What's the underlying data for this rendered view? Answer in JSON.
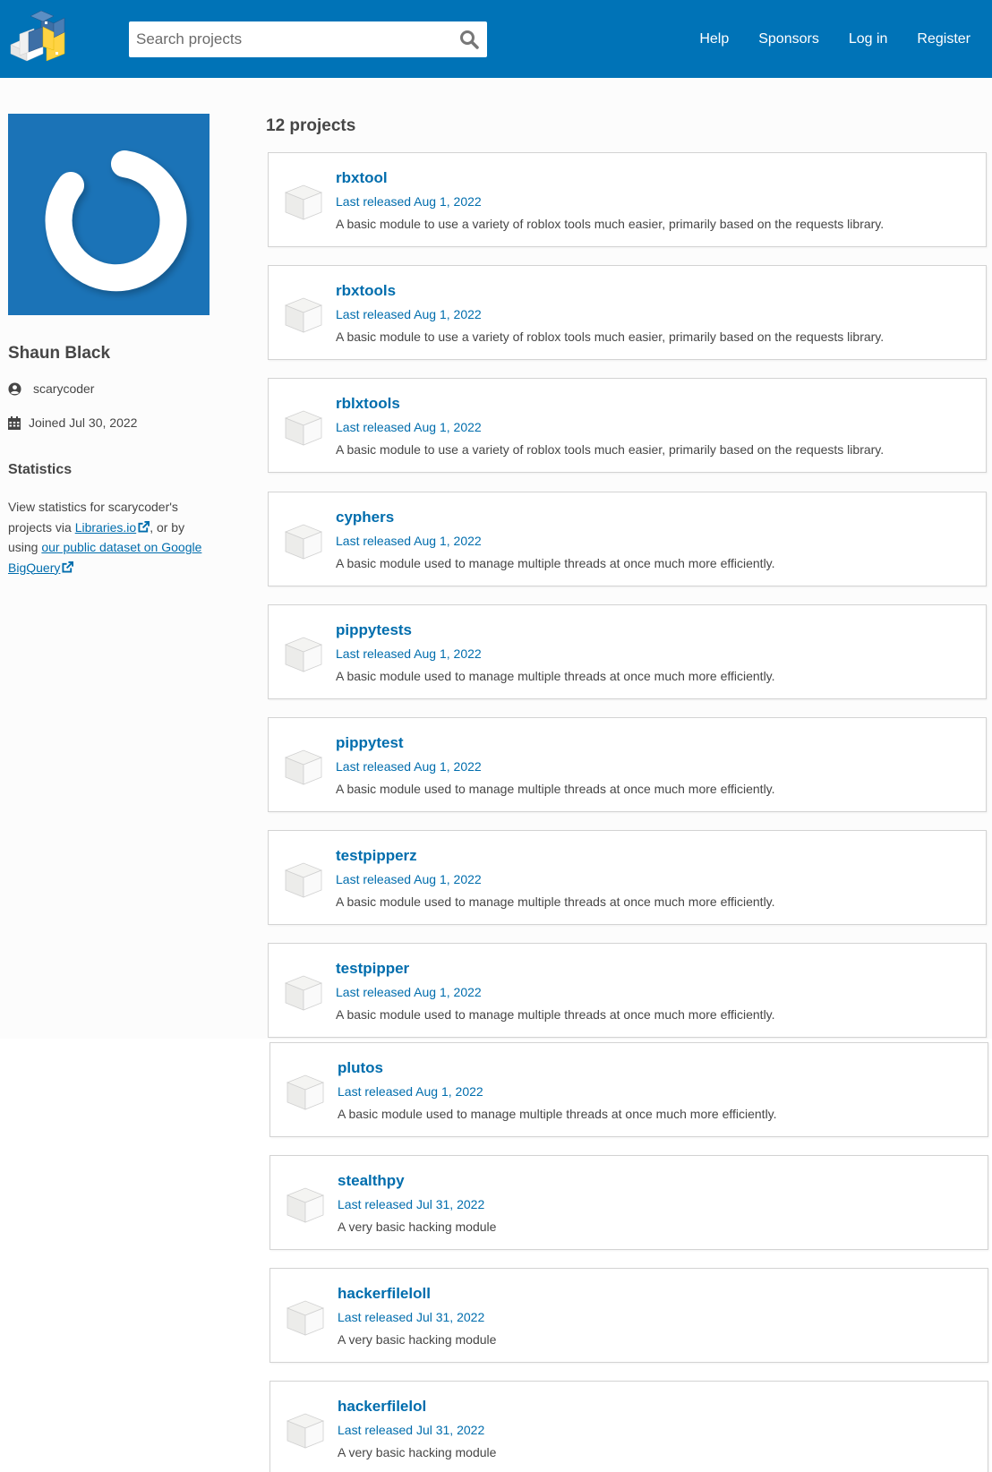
{
  "header": {
    "search_placeholder": "Search projects",
    "nav": [
      "Help",
      "Sponsors",
      "Log in",
      "Register"
    ],
    "brand_color": "#0073b7"
  },
  "profile": {
    "name": "Shaun Black",
    "username": "scarycoder",
    "joined": "Joined Jul 30, 2022",
    "statistics_title": "Statistics",
    "stats_text_1": "View statistics for scarycoder's projects via ",
    "stats_link_1": "Libraries.io",
    "stats_text_2": ", or by using ",
    "stats_link_2": "our public dataset on Google BigQuery"
  },
  "projects_count": "12 projects",
  "projects": [
    {
      "name": "rbxtool",
      "released": "Last released Aug 1, 2022",
      "description": "A basic module to use a variety of roblox tools much easier, primarily based on the requests library."
    },
    {
      "name": "rbxtools",
      "released": "Last released Aug 1, 2022",
      "description": "A basic module to use a variety of roblox tools much easier, primarily based on the requests library."
    },
    {
      "name": "rblxtools",
      "released": "Last released Aug 1, 2022",
      "description": "A basic module to use a variety of roblox tools much easier, primarily based on the requests library."
    },
    {
      "name": "cyphers",
      "released": "Last released Aug 1, 2022",
      "description": "A basic module used to manage multiple threads at once much more efficiently."
    },
    {
      "name": "pippytests",
      "released": "Last released Aug 1, 2022",
      "description": "A basic module used to manage multiple threads at once much more efficiently."
    },
    {
      "name": "pippytest",
      "released": "Last released Aug 1, 2022",
      "description": "A basic module used to manage multiple threads at once much more efficiently."
    },
    {
      "name": "testpipperz",
      "released": "Last released Aug 1, 2022",
      "description": "A basic module used to manage multiple threads at once much more efficiently."
    },
    {
      "name": "testpipper",
      "released": "Last released Aug 1, 2022",
      "description": "A basic module used to manage multiple threads at once much more efficiently."
    },
    {
      "name": "plutos",
      "released": "Last released Aug 1, 2022",
      "description": "A basic module used to manage multiple threads at once much more efficiently."
    },
    {
      "name": "stealthpy",
      "released": "Last released Jul 31, 2022",
      "description": "A very basic hacking module"
    },
    {
      "name": "hackerfileloll",
      "released": "Last released Jul 31, 2022",
      "description": "A very basic hacking module"
    },
    {
      "name": "hackerfilelol",
      "released": "Last released Jul 31, 2022",
      "description": "A very basic hacking module"
    }
  ]
}
